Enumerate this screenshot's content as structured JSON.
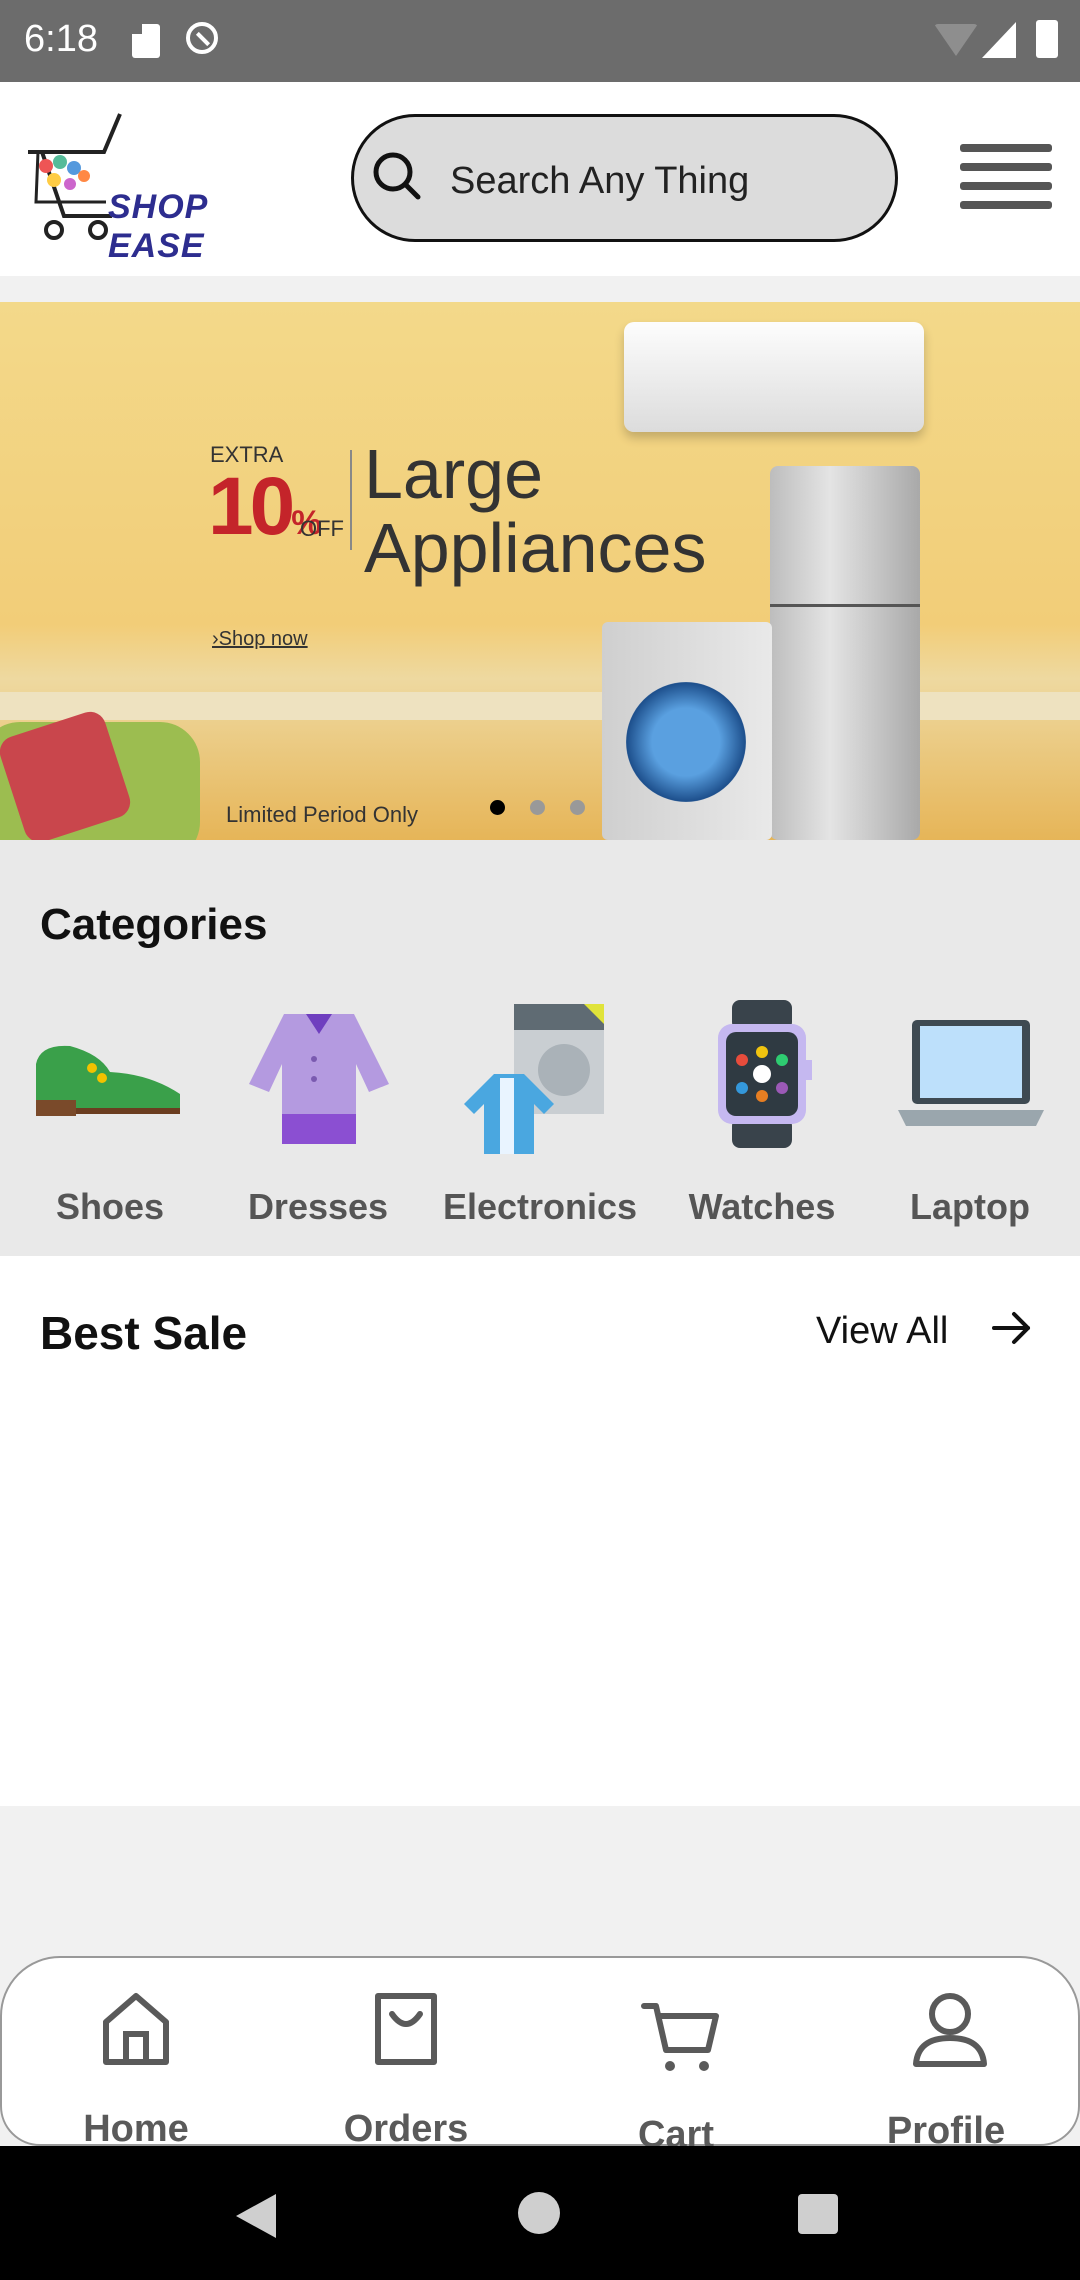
{
  "status_bar": {
    "time": "6:18"
  },
  "header": {
    "logo_text": "SHOP EASE",
    "search": {
      "placeholder": "Search Any Thing",
      "value": ""
    },
    "menu_icon": "hamburger-menu-icon"
  },
  "banner": {
    "extra": "EXTRA",
    "discount": "10",
    "percent": "%",
    "off": "OFF",
    "line1": "Large",
    "line2": "Appliances",
    "shop_now": "›Shop now",
    "limited": "Limited Period Only",
    "slide_count": 3,
    "active_slide": 0
  },
  "categories": {
    "title": "Categories",
    "items": [
      {
        "label": "Shoes",
        "icon": "shoe-icon"
      },
      {
        "label": "Dresses",
        "icon": "dress-icon"
      },
      {
        "label": "Electronics",
        "icon": "electronics-icon"
      },
      {
        "label": "Watches",
        "icon": "watch-icon"
      },
      {
        "label": "Laptop",
        "icon": "laptop-icon"
      }
    ]
  },
  "best_sale": {
    "title": "Best Sale",
    "view_all": "View All"
  },
  "bottom_nav": {
    "items": [
      {
        "label": "Home",
        "icon": "home-icon"
      },
      {
        "label": "Orders",
        "icon": "shopping-bag-icon"
      },
      {
        "label": "Cart",
        "icon": "cart-icon"
      },
      {
        "label": "Profile",
        "icon": "person-icon"
      }
    ]
  },
  "colors": {
    "brand_text": "#2d2d8f",
    "discount_red": "#c4242a",
    "category_bg": "#e9e9e9",
    "nav_label": "#5a5a5a"
  }
}
